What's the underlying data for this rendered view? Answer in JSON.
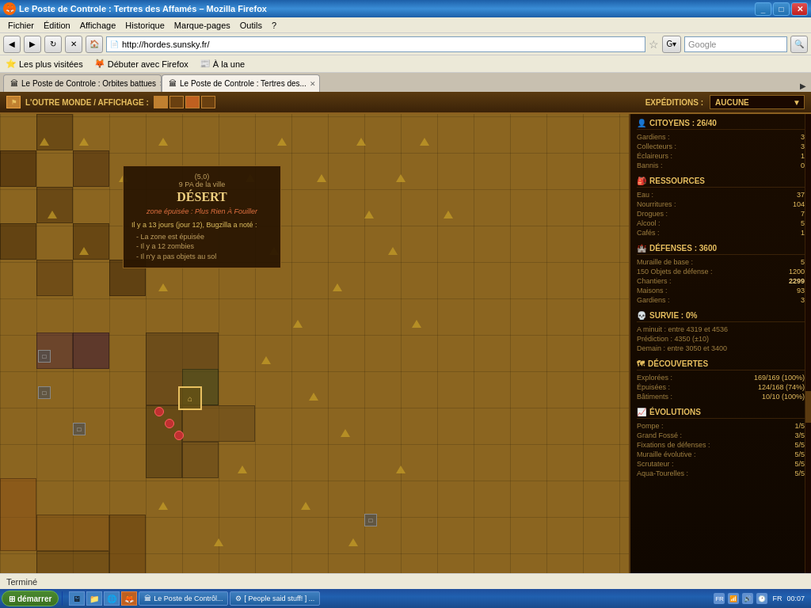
{
  "browser": {
    "title": "Le Poste de Controle : Tertres des Affamés – Mozilla Firefox",
    "icon": "🦊",
    "menu": {
      "items": [
        "Fichier",
        "Édition",
        "Affichage",
        "Historique",
        "Marque-pages",
        "Outils",
        "?"
      ]
    },
    "address": "http://hordes.sunsky.fr/",
    "search_placeholder": "Google",
    "bookmarks": [
      {
        "label": "Les plus visitées",
        "icon": "⭐"
      },
      {
        "label": "Débuter avec Firefox",
        "icon": "🦊"
      },
      {
        "label": "À la une",
        "icon": "📰"
      }
    ],
    "tabs": [
      {
        "label": "Le Poste de Controle : Orbites battues",
        "active": false,
        "icon": "🏛"
      },
      {
        "label": "Le Poste de Controle : Tertres des...",
        "active": true,
        "icon": "🏛"
      }
    ]
  },
  "game": {
    "topbar": {
      "breadcrumb": "L'OUTRE MONDE / AFFICHAGE :",
      "expeditions_label": "EXPÉDITIONS :",
      "expeditions_value": "AUCUNE"
    },
    "tooltip": {
      "coord": "(5,0)",
      "pa": "9 PA de la ville",
      "type": "DÉSERT",
      "zone_label": "zone épuisée : Plus Rien À Fouiller",
      "note_header": "Il y a 13 jours (jour 12), Bugzilla a noté :",
      "notes": [
        "- La zone est épuisée",
        "- Il y a 12 zombies",
        "- Il n'y a pas objets au sol"
      ]
    },
    "citizens": {
      "title": "CITOYENS : 26/40",
      "rows": [
        {
          "label": "Gardiens :",
          "value": "3"
        },
        {
          "label": "Collecteurs :",
          "value": "3"
        },
        {
          "label": "Éclaireurs :",
          "value": "1"
        },
        {
          "label": "Bannis :",
          "value": "0"
        }
      ]
    },
    "resources": {
      "title": "RESSOURCES",
      "rows": [
        {
          "label": "Eau :",
          "value": "37"
        },
        {
          "label": "Nourritures :",
          "value": "104"
        },
        {
          "label": "Drogues :",
          "value": "7"
        },
        {
          "label": "Alcool :",
          "value": "5"
        },
        {
          "label": "Cafés :",
          "value": "1"
        }
      ]
    },
    "defenses": {
      "title": "DÉFENSES : 3600",
      "rows": [
        {
          "label": "Muraille de base :",
          "value": "5"
        },
        {
          "label": "150 Objets de défense :",
          "value": "1200"
        },
        {
          "label": "Chantiers :",
          "value": "2299"
        },
        {
          "label": "Maisons :",
          "value": "93"
        },
        {
          "label": "Gardiens :",
          "value": "3"
        }
      ]
    },
    "survival": {
      "title": "SURVIE : 0%",
      "rows": [
        {
          "label": "A minuit : entre 4319 et 4536",
          "value": ""
        },
        {
          "label": "Prédiction : 4350 (±10)",
          "value": ""
        },
        {
          "label": "Demain : entre 3050 et 3400",
          "value": ""
        }
      ]
    },
    "discoveries": {
      "title": "DÉCOUVERTES",
      "rows": [
        {
          "label": "Explorées :",
          "value": "169/169 (100%)"
        },
        {
          "label": "Épuisées :",
          "value": "124/168 (74%)"
        },
        {
          "label": "Bâtiments :",
          "value": "10/10 (100%)"
        }
      ]
    },
    "evolutions": {
      "title": "ÉVOLUTIONS",
      "rows": [
        {
          "label": "Pompe :",
          "value": "1/5"
        },
        {
          "label": "Grand Fossé :",
          "value": "3/5"
        },
        {
          "label": "Fixations de défenses :",
          "value": "5/5"
        },
        {
          "label": "Muraille évolutive :",
          "value": "5/5"
        },
        {
          "label": "Scrutateur :",
          "value": "5/5"
        },
        {
          "label": "Aqua-Tourelles :",
          "value": "5/5"
        }
      ]
    }
  },
  "status_bar": {
    "text": "Terminé"
  },
  "taskbar": {
    "language": "FR",
    "time": "00:07",
    "items": [
      {
        "label": "Le Poste de Contrôl...",
        "active": false,
        "icon": "🏛"
      },
      {
        "label": "[ People said stuff! ] ...",
        "active": false,
        "icon": "⚙"
      }
    ]
  }
}
